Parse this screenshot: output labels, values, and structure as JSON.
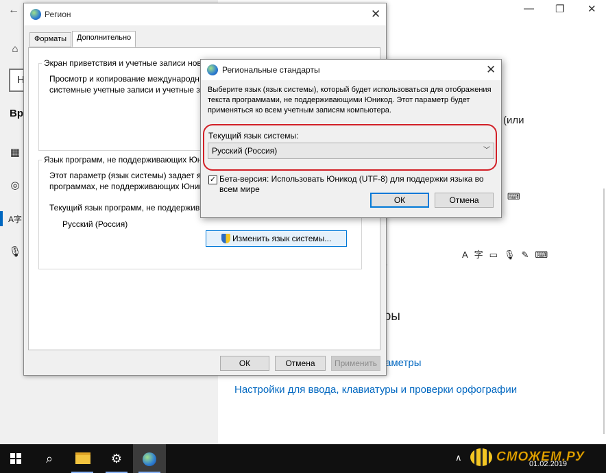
{
  "settings": {
    "left_heading": "Вре",
    "search_letter": "Н",
    "fragments": {
      "ili": "(или",
      "tr": "тры",
      "params_link": "аметры",
      "t_char": "т"
    },
    "input_link": "Настройки для ввода, клавиатуры и проверки орфографии",
    "window_controls": {
      "minimize": "—",
      "restore": "❐",
      "close": "✕"
    }
  },
  "region_dialog": {
    "title": "Регион",
    "tabs": [
      {
        "label": "Форматы",
        "active": false
      },
      {
        "label": "Дополнительно",
        "active": true
      }
    ],
    "group1": {
      "title": "Экран приветствия и учетные записи нов",
      "line1": "Просмотр и копирование международн",
      "line2": "системные учетные записи и учетные за"
    },
    "group2": {
      "title": "Язык программ, не поддерживающих Юн",
      "line1": "Этот параметр (язык системы) задает язь",
      "line2": "программах, не поддерживающих Юник",
      "line3": "Текущий язык программ, не поддержив",
      "current_language": "Русский (Россия)",
      "change_button": "Изменить язык системы..."
    },
    "buttons": {
      "ok": "ОК",
      "cancel": "Отмена",
      "apply": "Применить"
    }
  },
  "standards_dialog": {
    "title": "Региональные стандарты",
    "description": "Выберите язык (язык системы), который будет использоваться для отображения текста программами, не поддерживающими Юникод. Этот параметр будет применяться ко всем учетным записям компьютера.",
    "select_label": "Текущий язык системы:",
    "selected_value": "Русский (Россия)",
    "beta_checkbox": {
      "checked": true,
      "label": "Бета-версия: Использовать Юникод (UTF-8) для поддержки языка во всем мире"
    },
    "buttons": {
      "ok": "ОК",
      "cancel": "Отмена"
    },
    "highlight_color": "#d21f26"
  },
  "taskbar": {
    "date": "01.02.2019",
    "watermark": "СМОЖЕМ.РУ"
  }
}
